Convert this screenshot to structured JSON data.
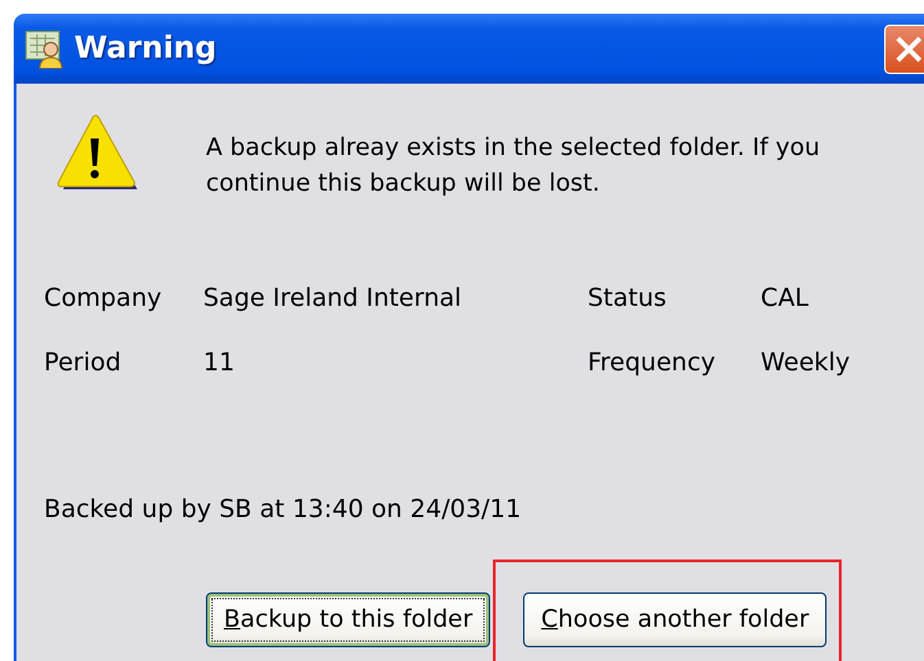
{
  "window": {
    "title": "Warning"
  },
  "message": "A backup alreay exists in the selected folder. If you continue this backup will be lost.",
  "details": [
    {
      "label": "Company",
      "value": "Sage Ireland Internal"
    },
    {
      "label": "Status",
      "value": "CAL"
    },
    {
      "label": "Period",
      "value": "11"
    },
    {
      "label": "Frequency",
      "value": "Weekly"
    }
  ],
  "backup_info": "Backed up by SB at 13:40 on 24/03/11",
  "buttons": [
    {
      "label": "Backup to this folder",
      "default": true,
      "highlighted": false
    },
    {
      "label": "Choose another folder",
      "default": false,
      "highlighted": true
    }
  ]
}
